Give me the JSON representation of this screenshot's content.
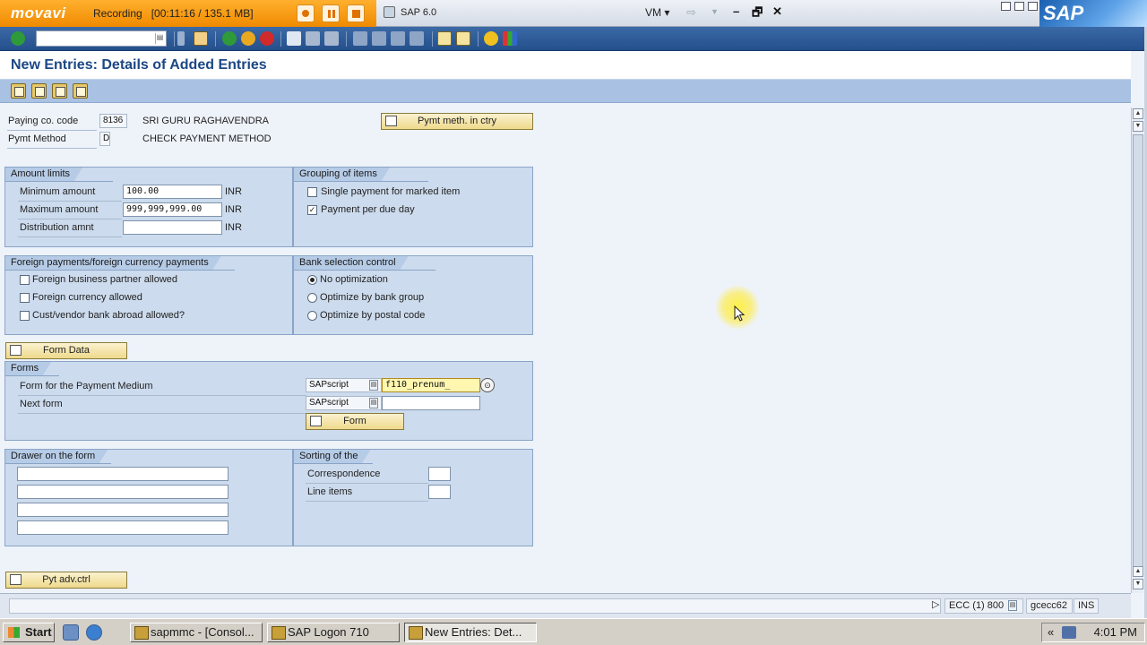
{
  "recorder": {
    "logo": "movavi",
    "status": "Recording",
    "time": "[00:11:16 / 135.1 MB]"
  },
  "window": {
    "title": "SAP 6.0",
    "vm_label": "VM",
    "sap_logo": "SAP"
  },
  "toolbar": {
    "command_field_value": "",
    "icons": [
      "enter-icon",
      "command-dropdown-icon",
      "save-icon",
      "back-icon",
      "exit-icon",
      "cancel-icon",
      "print-icon",
      "find-icon",
      "find-next-icon",
      "first-page-icon",
      "previous-page-icon",
      "next-page-icon",
      "last-page-icon",
      "new-session-icon",
      "shortcut-icon",
      "help-icon",
      "customize-layout-icon"
    ]
  },
  "page": {
    "title": "New Entries: Details of Added Entries",
    "app_toolbar_icons": [
      "change-icon",
      "select-all-icon",
      "copy-icon",
      "delete-icon"
    ]
  },
  "header": {
    "paying_co_code_label": "Paying co. code",
    "paying_co_code_value": "8136",
    "paying_co_name": "SRI GURU RAGHAVENDRA",
    "pymt_method_label": "Pymt Method",
    "pymt_method_value": "D",
    "pymt_method_desc": "CHECK PAYMENT METHOD",
    "pymt_meth_in_ctry_button": "Pymt meth. in ctry"
  },
  "amount_limits": {
    "title": "Amount limits",
    "min_label": "Minimum amount",
    "min_value": "100.00",
    "max_label": "Maximum amount",
    "max_value": "999,999,999.00",
    "dist_label": "Distribution amnt",
    "dist_value": "",
    "currency": "INR"
  },
  "grouping": {
    "title": "Grouping of items",
    "items": [
      {
        "label": "Single payment for marked item",
        "checked": false
      },
      {
        "label": "Payment per due day",
        "checked": true
      }
    ]
  },
  "foreign": {
    "title": "Foreign payments/foreign currency payments",
    "items": [
      {
        "label": "Foreign business partner allowed",
        "checked": false
      },
      {
        "label": "Foreign currency allowed",
        "checked": false
      },
      {
        "label": "Cust/vendor bank abroad allowed?",
        "checked": false
      }
    ]
  },
  "bank_selection": {
    "title": "Bank selection control",
    "items": [
      {
        "label": "No optimization",
        "selected": true
      },
      {
        "label": "Optimize by bank group",
        "selected": false
      },
      {
        "label": "Optimize by postal code",
        "selected": false
      }
    ]
  },
  "form_data_button": "Form Data",
  "forms": {
    "title": "Forms",
    "payment_medium_label": "Form for the Payment Medium",
    "payment_medium_type": "SAPscript",
    "payment_medium_value": "f110_prenum_",
    "next_form_label": "Next form",
    "next_form_type": "SAPscript",
    "next_form_value": "",
    "form_button": "Form"
  },
  "drawer": {
    "title": "Drawer on the form",
    "lines": [
      "",
      "",
      "",
      ""
    ]
  },
  "sorting": {
    "title": "Sorting of the",
    "correspondence_label": "Correspondence",
    "correspondence_value": "",
    "line_items_label": "Line items",
    "line_items_value": ""
  },
  "pyt_adv_ctrl_button": "Pyt adv.ctrl",
  "statusbar": {
    "system": "ECC (1) 800",
    "server": "gcecc62",
    "mode": "INS"
  },
  "taskbar": {
    "start": "Start",
    "tasks": [
      "sapmmc - [Consol...",
      "SAP Logon 710",
      "New Entries: Det..."
    ],
    "clock": "4:01 PM"
  }
}
